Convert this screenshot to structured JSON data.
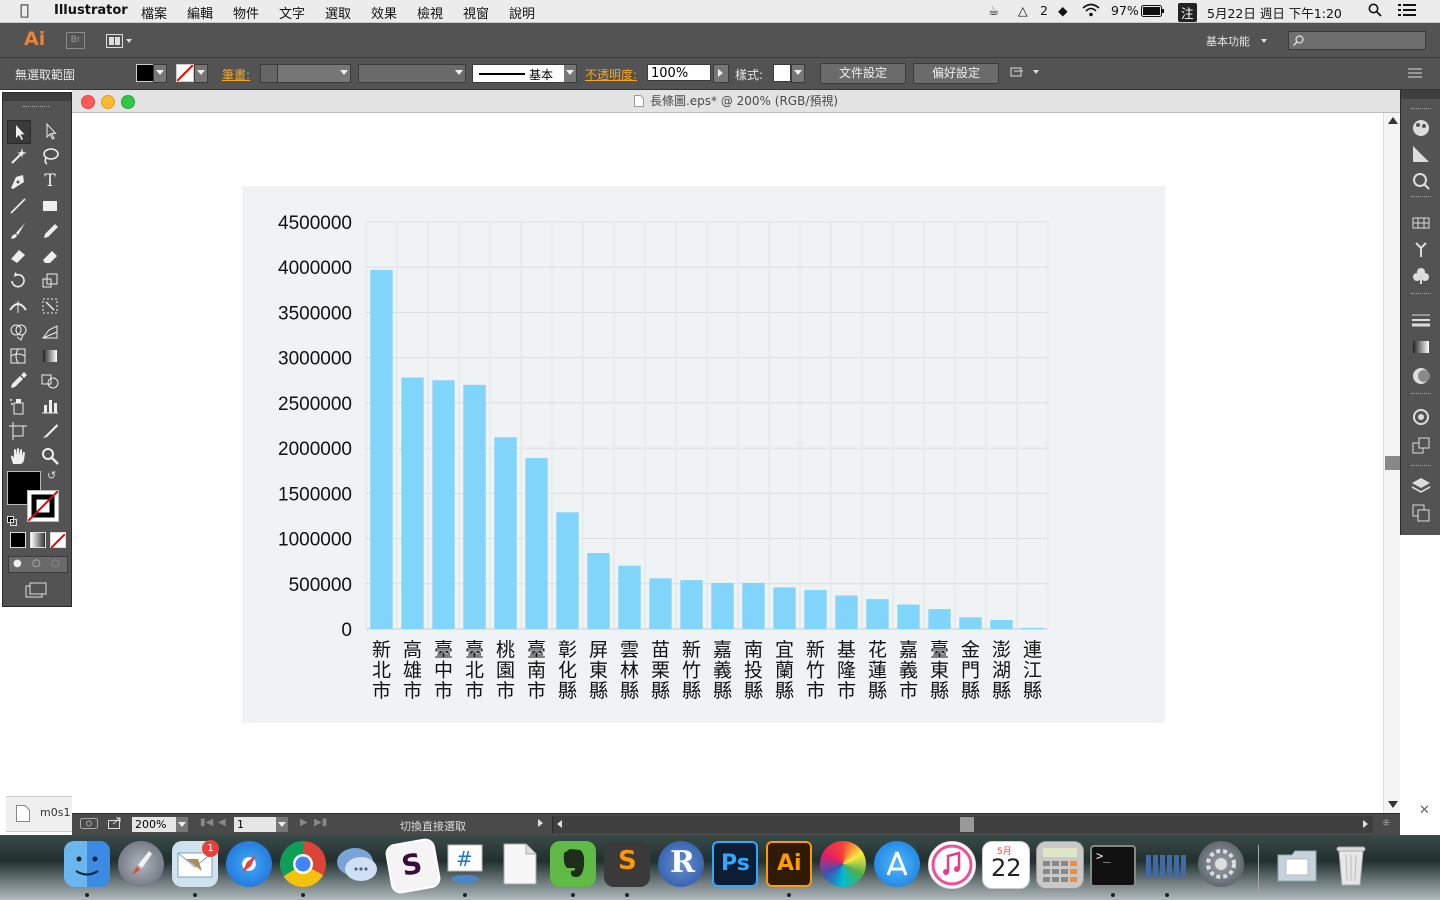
{
  "menubar": {
    "app_name": "Illustrator",
    "items": [
      "檔案",
      "編輯",
      "物件",
      "文字",
      "選取",
      "效果",
      "檢視",
      "視窗",
      "說明"
    ],
    "status": {
      "adobe_count": "2",
      "battery": "97%",
      "ime": "注",
      "datetime": "5月22日 週日 下午1:20"
    }
  },
  "appbar": {
    "logo": "Ai",
    "bridge": "Br",
    "workspace_label": "基本功能"
  },
  "controlbar": {
    "selection": "無選取範圍",
    "stroke_label": "筆畫:",
    "stroke_style": "基本",
    "opacity_label": "不透明度:",
    "opacity_value": "100%",
    "style_label": "樣式:",
    "doc_setup": "文件設定",
    "preferences": "偏好設定"
  },
  "document": {
    "title": "長條圖.eps* @ 200% (RGB/預視)",
    "zoom": "200%",
    "artboard": "1",
    "status_text": "切換直接選取",
    "side_file": "m0s1"
  },
  "colors": {
    "bar": "#81d4fa",
    "chart_bg": "#f0f3f4",
    "ui_dark": "#535353",
    "accent_orange": "#f5a623"
  },
  "chart_data": {
    "type": "bar",
    "categories": [
      "新北市",
      "高雄市",
      "臺中市",
      "臺北市",
      "桃園市",
      "臺南市",
      "彰化縣",
      "屏東縣",
      "雲林縣",
      "苗栗縣",
      "新竹縣",
      "嘉義縣",
      "南投縣",
      "宜蘭縣",
      "新竹市",
      "基隆市",
      "花蓮縣",
      "嘉義市",
      "臺東縣",
      "金門縣",
      "澎湖縣",
      "連江縣"
    ],
    "values": [
      3970000,
      2780000,
      2750000,
      2700000,
      2120000,
      1890000,
      1290000,
      840000,
      700000,
      560000,
      540000,
      510000,
      510000,
      460000,
      430000,
      370000,
      330000,
      270000,
      220000,
      130000,
      100000,
      12000
    ],
    "yticks": [
      "0",
      "500000",
      "1000000",
      "1500000",
      "2000000",
      "2500000",
      "3000000",
      "3500000",
      "4000000",
      "4500000"
    ],
    "ylim": [
      0,
      4500000
    ],
    "grid": true,
    "title": "",
    "xlabel": "",
    "ylabel": ""
  },
  "dock": {
    "apps": [
      "finder-icon",
      "launchpad-icon",
      "mail-icon",
      "safari-icon",
      "chrome-icon",
      "messages-icon",
      "slack-icon",
      "keynote-icon",
      "textedit-icon",
      "evernote-icon",
      "sublime-icon",
      "r-icon",
      "photoshop-icon",
      "illustrator-icon",
      "color-picker-icon",
      "app-store-icon",
      "itunes-icon",
      "calendar-icon",
      "calculator-icon",
      "terminal-icon",
      "activity-icon",
      "system-preferences-icon",
      "documents-folder-icon",
      "trash-icon"
    ],
    "mail_badge": "1",
    "calendar_month": "5月",
    "calendar_day": "22",
    "ps_label": "Ps",
    "ai_label": "Ai",
    "r_label": "R",
    "sublime_label": "S"
  }
}
